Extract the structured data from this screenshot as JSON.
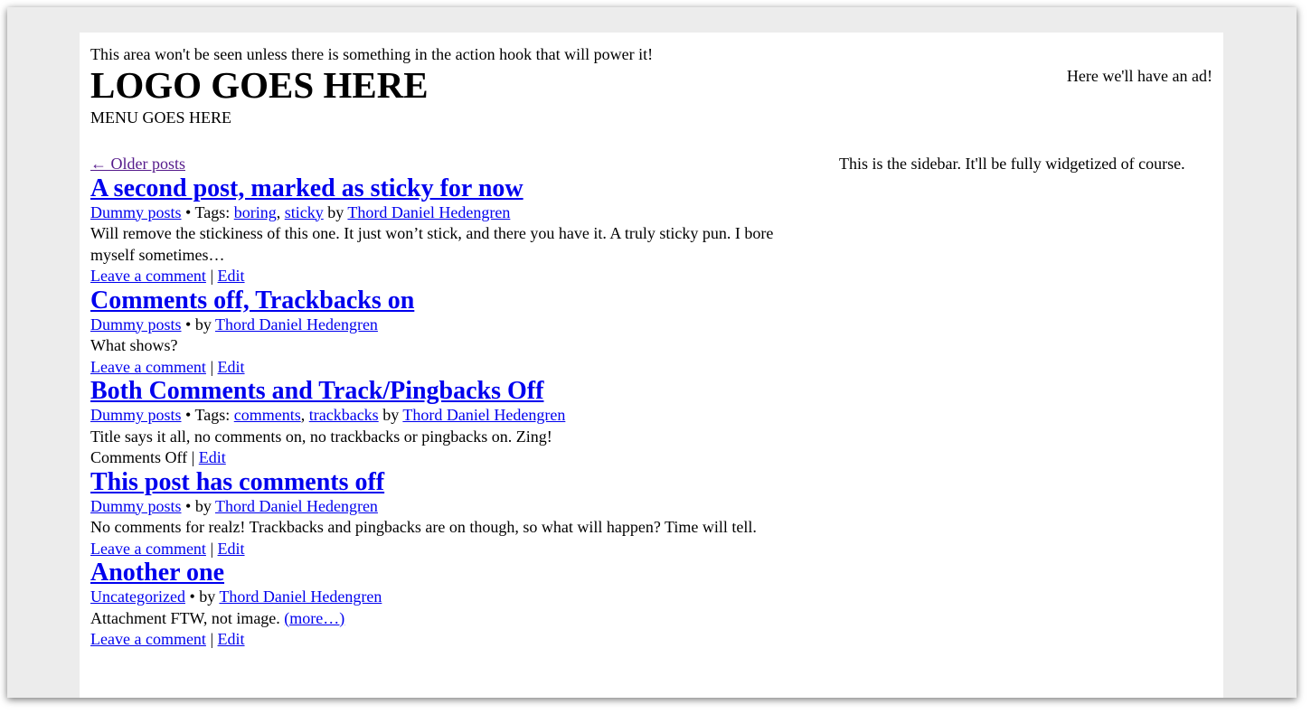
{
  "header": {
    "hook_notice": "This area won't be seen unless there is something in the action hook that will power it!",
    "logo": "LOGO GOES HERE",
    "menu": "MENU GOES HERE",
    "ad": "Here we'll have an ad!"
  },
  "nav": {
    "older_posts": "← Older posts"
  },
  "posts": [
    {
      "title": "A second post, marked as sticky for now",
      "category": "Dummy posts",
      "tags_prefix": " • Tags: ",
      "tags": [
        "boring",
        "sticky"
      ],
      "by": " by ",
      "author": "Thord Daniel Hedengren",
      "excerpt": "Will remove the stickiness of this one. It just won’t stick, and there you have it. A truly sticky pun. I bore myself sometimes…",
      "comment": "Leave a comment",
      "edit": "Edit"
    },
    {
      "title": "Comments off, Trackbacks on",
      "category": "Dummy posts",
      "by": " • by ",
      "author": "Thord Daniel Hedengren",
      "excerpt": "What shows?",
      "comment": "Leave a comment",
      "edit": "Edit"
    },
    {
      "title": "Both Comments and Track/Pingbacks Off",
      "category": "Dummy posts",
      "tags_prefix": " • Tags: ",
      "tags": [
        "comments",
        "trackbacks"
      ],
      "by": " by ",
      "author": "Thord Daniel Hedengren",
      "excerpt": "Title says it all, no comments on, no trackbacks or pingbacks on. Zing!",
      "comments_off": "Comments Off",
      "edit": "Edit"
    },
    {
      "title": "This post has comments off",
      "category": "Dummy posts",
      "by": " • by ",
      "author": "Thord Daniel Hedengren",
      "excerpt": "No comments for realz! Trackbacks and pingbacks are on though, so what will happen? Time will tell.",
      "comment": "Leave a comment",
      "edit": "Edit"
    },
    {
      "title": "Another one",
      "category": "Uncategorized",
      "by": " • by ",
      "author": "Thord Daniel Hedengren",
      "excerpt": "Attachment FTW, not image. ",
      "more": "(more…)",
      "comment": "Leave a comment",
      "edit": "Edit"
    }
  ],
  "separators": {
    "pipe": " | ",
    "comma": ", "
  },
  "sidebar": {
    "text": "This is the sidebar. It'll be fully widgetized of course."
  }
}
